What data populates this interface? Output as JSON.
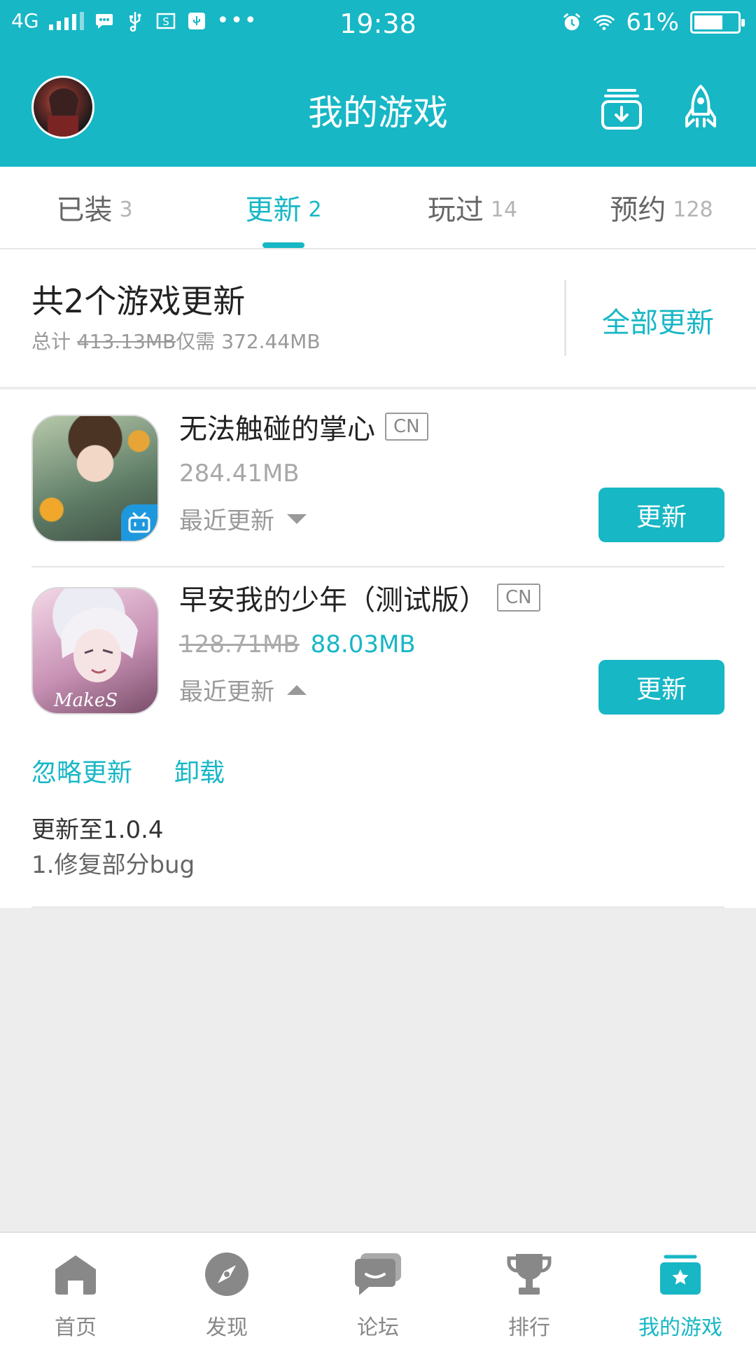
{
  "status_bar": {
    "network": "4G",
    "time": "19:38",
    "battery": "61%",
    "battery_level": 0.61
  },
  "header": {
    "title": "我的游戏",
    "download_icon": "download-icon",
    "rocket_icon": "rocket-icon"
  },
  "tabs": [
    {
      "label": "已装",
      "count": "3"
    },
    {
      "label": "更新",
      "count": "2"
    },
    {
      "label": "玩过",
      "count": "14"
    },
    {
      "label": "预约",
      "count": "128"
    }
  ],
  "active_tab": "更新",
  "summary": {
    "title": "共2个游戏更新",
    "total_label": "总计",
    "original_size": "413.13MB",
    "only_need": "仅需",
    "new_size": "372.44MB",
    "update_all": "全部更新"
  },
  "games": [
    {
      "name": "无法触碰的掌心",
      "region": "CN",
      "size": "284.41MB",
      "recent_label": "最近更新",
      "button": "更新"
    },
    {
      "name": "早安我的少年（测试版）",
      "region": "CN",
      "old_size": "128.71MB",
      "new_size": "88.03MB",
      "recent_label": "最近更新",
      "button": "更新",
      "ignore": "忽略更新",
      "uninstall": "卸载",
      "notes_title": "更新至1.0.4",
      "notes_line": "1.修复部分bug"
    }
  ],
  "bottom_nav": [
    {
      "label": "首页",
      "icon": "home-icon"
    },
    {
      "label": "发现",
      "icon": "compass-icon"
    },
    {
      "label": "论坛",
      "icon": "chat-icon"
    },
    {
      "label": "排行",
      "icon": "trophy-icon"
    },
    {
      "label": "我的游戏",
      "icon": "my-games-icon"
    }
  ],
  "colors": {
    "accent": "#17b7c5",
    "background": "#ededed",
    "text": "#222222",
    "muted": "#999999"
  }
}
